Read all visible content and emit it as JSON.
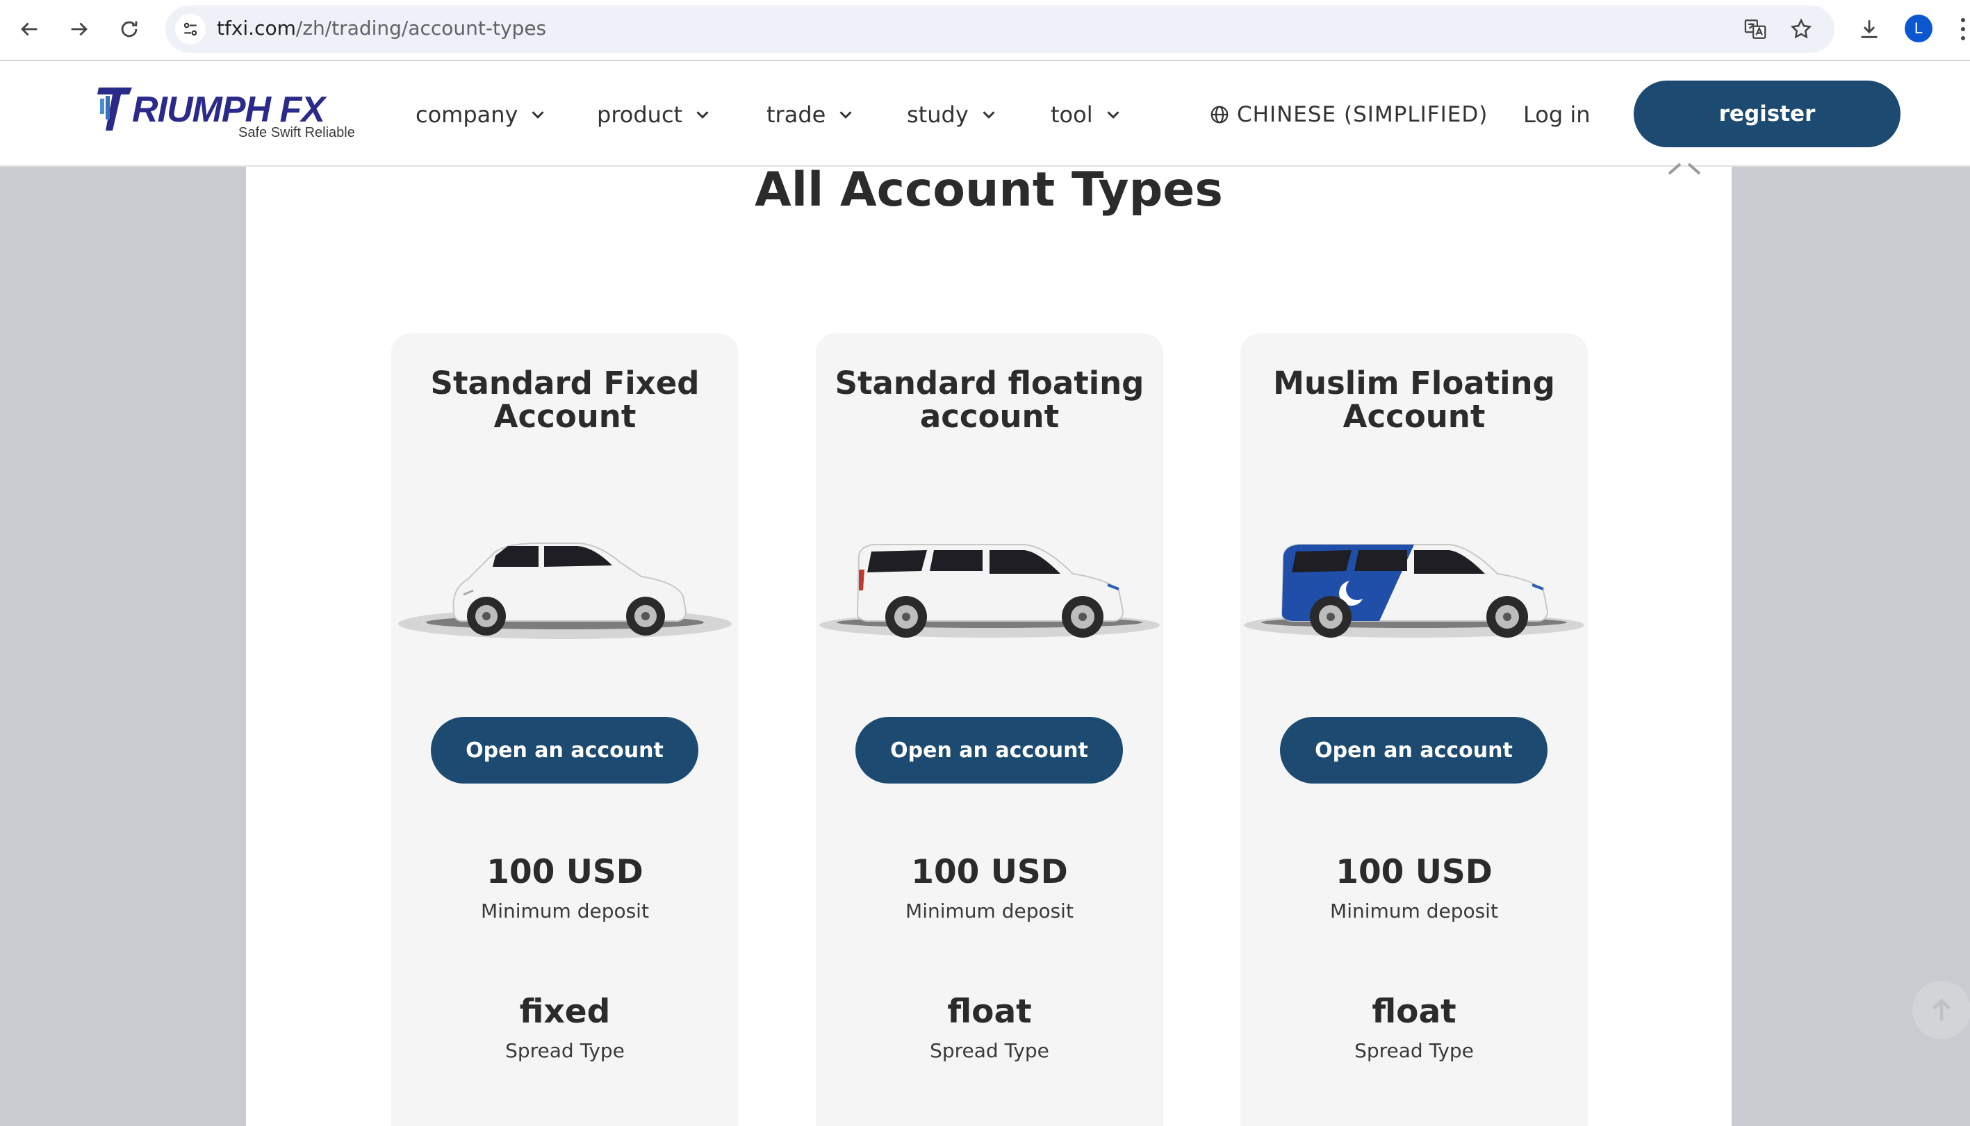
{
  "browser": {
    "url_host": "tfxi.com",
    "url_path": "/zh/trading/account-types",
    "profile_initial": "L"
  },
  "header": {
    "logo_word": "RIUMPH FX",
    "logo_tagline": "Safe Swift Reliable",
    "menu": [
      {
        "label": "company"
      },
      {
        "label": "product"
      },
      {
        "label": "trade"
      },
      {
        "label": "study"
      },
      {
        "label": "tool"
      }
    ],
    "language": "CHINESE (SIMPLIFIED)",
    "login": "Log in",
    "register": "register"
  },
  "main": {
    "title": "All Account Types",
    "cards": [
      {
        "title_line1": "Standard Fixed",
        "title_line2": "Account",
        "car_icon": "white-hatchback-icon",
        "button": "Open an account",
        "deposit_value": "100 USD",
        "deposit_label": "Minimum deposit",
        "spread_value": "fixed",
        "spread_label": "Spread Type"
      },
      {
        "title_line1": "Standard floating",
        "title_line2": "account",
        "car_icon": "white-van-icon",
        "button": "Open an account",
        "deposit_value": "100 USD",
        "deposit_label": "Minimum deposit",
        "spread_value": "float",
        "spread_label": "Spread Type"
      },
      {
        "title_line1": "Muslim Floating",
        "title_line2": "Account",
        "car_icon": "crescent-van-icon",
        "button": "Open an account",
        "deposit_value": "100 USD",
        "deposit_label": "Minimum deposit",
        "spread_value": "float",
        "spread_label": "Spread Type"
      }
    ]
  },
  "colors": {
    "brand": "#1c4a70",
    "logo": "#2a2a8a",
    "backdrop": "#cacbd0",
    "card": "#f5f5f6"
  }
}
